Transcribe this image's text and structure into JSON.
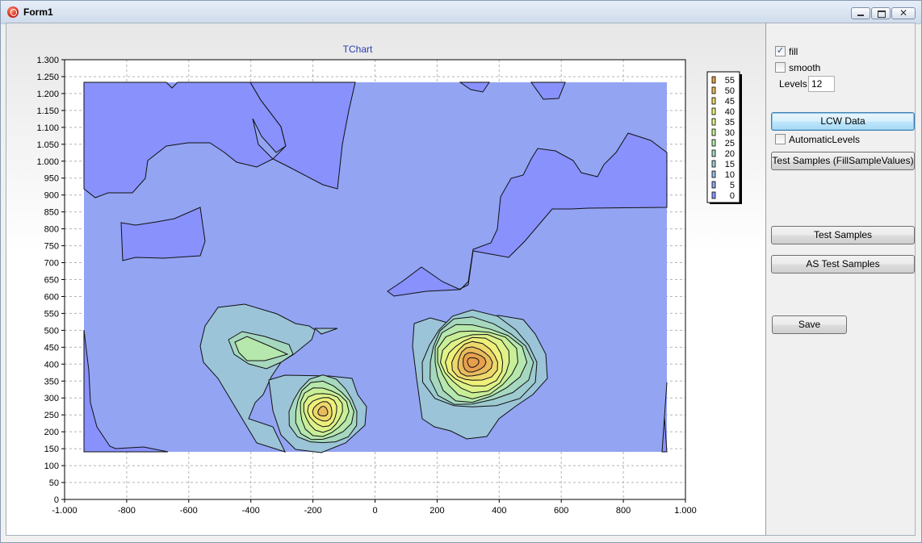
{
  "window": {
    "title": "Form1",
    "minimize_glyph": "",
    "maximize_glyph": "",
    "close_glyph": "✕"
  },
  "chart": {
    "title": "TChart",
    "x_ticks": [
      "-1.000",
      "-800",
      "-600",
      "-400",
      "-200",
      "0",
      "200",
      "400",
      "600",
      "800",
      "1.000"
    ],
    "y_ticks": [
      "0",
      "50",
      "100",
      "150",
      "200",
      "250",
      "300",
      "350",
      "400",
      "450",
      "500",
      "550",
      "600",
      "650",
      "700",
      "750",
      "800",
      "850",
      "900",
      "950",
      "1.000",
      "1.050",
      "1.100",
      "1.150",
      "1.200",
      "1.250",
      "1.300"
    ]
  },
  "chart_data": {
    "type": "heatmap",
    "subtype": "contour",
    "title": "TChart",
    "xlim": [
      -1000,
      1000
    ],
    "ylim": [
      0,
      1300
    ],
    "grid": true,
    "legend_position": "right",
    "levels": [
      55,
      50,
      45,
      40,
      35,
      30,
      25,
      20,
      15,
      10,
      5,
      0
    ],
    "peaks": [
      {
        "x": 315,
        "y": 390,
        "value": 55
      },
      {
        "x": -190,
        "y": 270,
        "value": 40
      },
      {
        "x": -400,
        "y": 510,
        "value": 25
      }
    ]
  },
  "legend": {
    "items": [
      {
        "label": "55",
        "color": "#e6a04d"
      },
      {
        "label": "50",
        "color": "#e8bb5e"
      },
      {
        "label": "45",
        "color": "#eed86c"
      },
      {
        "label": "40",
        "color": "#eef07a"
      },
      {
        "label": "35",
        "color": "#dff28a"
      },
      {
        "label": "30",
        "color": "#c8ef98"
      },
      {
        "label": "25",
        "color": "#b6e8ad"
      },
      {
        "label": "20",
        "color": "#a6d8bf"
      },
      {
        "label": "15",
        "color": "#9ccbd0"
      },
      {
        "label": "10",
        "color": "#98bde0"
      },
      {
        "label": "5",
        "color": "#8fa8f2"
      },
      {
        "label": "0",
        "color": "#8a95fb"
      }
    ]
  },
  "panel": {
    "fill_label": "fill",
    "fill_checked": "✓",
    "smooth_label": "smooth",
    "smooth_checked": "",
    "levels_label": "Levels",
    "levels_value": "12",
    "lcw_button": "LCW Data",
    "auto_levels_label": "AutomaticLevels",
    "auto_levels_checked": "",
    "test_fill_button": "Test Samples (FillSampleValues)",
    "test_samples_button": "Test Samples",
    "as_test_button": "AS Test Samples",
    "save_button": "Save"
  },
  "colors": {
    "plot_base": "#93a4f3",
    "low_region": "#8891fc",
    "title": "#2b3bb0"
  }
}
